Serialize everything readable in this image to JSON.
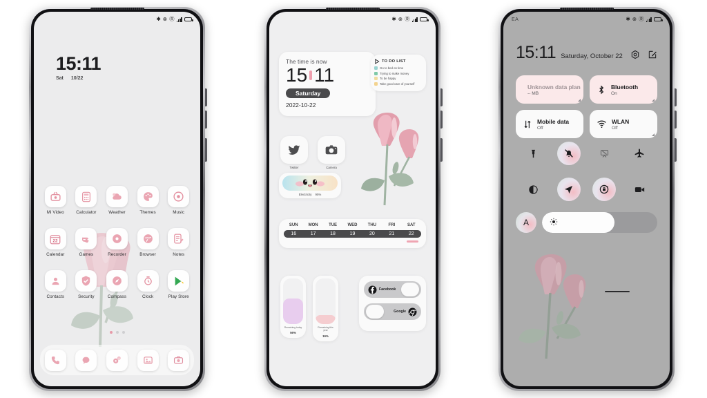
{
  "theme": {
    "pink": "#e79aa8",
    "petal": "#e8a0ae",
    "leaf": "#9caf9e",
    "home_bg": "#ececed",
    "cc_bg": "#adadad"
  },
  "phone1": {
    "name": "home-screen",
    "statusbar": {
      "icons": [
        "bluetooth-icon",
        "no-wifi-icon",
        "ringer-icon",
        "signal-icon",
        "battery-icon"
      ]
    },
    "clock": {
      "time": "15:11",
      "weekday": "Sat",
      "date": "10/22"
    },
    "apps": [
      {
        "label": "Mi Video",
        "icon": "mi-video-icon"
      },
      {
        "label": "Calculator",
        "icon": "calculator-icon"
      },
      {
        "label": "Weather",
        "icon": "weather-icon"
      },
      {
        "label": "Themes",
        "icon": "themes-icon"
      },
      {
        "label": "Music",
        "icon": "music-icon"
      },
      {
        "label": "Calendar",
        "icon": "calendar-icon",
        "badge": "22"
      },
      {
        "label": "Games",
        "icon": "games-icon"
      },
      {
        "label": "Recorder",
        "icon": "recorder-icon"
      },
      {
        "label": "Browser",
        "icon": "browser-icon"
      },
      {
        "label": "Notes",
        "icon": "notes-icon"
      },
      {
        "label": "Contacts",
        "icon": "contacts-icon"
      },
      {
        "label": "Security",
        "icon": "security-icon"
      },
      {
        "label": "Compass",
        "icon": "compass-icon"
      },
      {
        "label": "Clock",
        "icon": "clock-icon"
      },
      {
        "label": "Play Store",
        "icon": "play-store-icon"
      }
    ],
    "page_dots": {
      "count": 3,
      "active": 0
    },
    "dock": [
      {
        "label": "Phone",
        "icon": "phone-icon"
      },
      {
        "label": "Messages",
        "icon": "messages-icon"
      },
      {
        "label": "Settings",
        "icon": "settings-icon"
      },
      {
        "label": "Gallery",
        "icon": "gallery-icon"
      },
      {
        "label": "Camera",
        "icon": "camera-icon"
      }
    ]
  },
  "phone2": {
    "name": "widget-screen",
    "time_widget": {
      "lead": "The time is now",
      "hours": "15",
      "minutes": "11",
      "weekday": "Saturday",
      "date": "2022-10-22"
    },
    "todo_widget": {
      "title": "TO DO LIST",
      "items": [
        {
          "text": "Go to bed on time",
          "color": "#9ad3d0",
          "checked": false
        },
        {
          "text": "Trying to make money",
          "color": "#7fc9a8",
          "checked": true
        },
        {
          "text": "To be happy",
          "color": "#f0dca0",
          "checked": false
        },
        {
          "text": "Take good care of yourself",
          "color": "#f3d38e",
          "checked": true
        }
      ]
    },
    "apps": [
      {
        "label": "Twitter",
        "icon": "twitter-icon"
      },
      {
        "label": "Camera",
        "icon": "camera-icon"
      }
    ],
    "battery_widget": {
      "label": "Electricity",
      "value": "95%",
      "face": "kawaii-face-icon"
    },
    "calendar_widget": {
      "weekdays": [
        "SUN",
        "MON",
        "TUE",
        "WED",
        "THU",
        "FRI",
        "SAT"
      ],
      "dates": [
        "16",
        "17",
        "18",
        "19",
        "20",
        "21",
        "22"
      ],
      "selected_index": 6
    },
    "progress_widgets": [
      {
        "label": "Remaining today",
        "value": "56%",
        "percent": 56,
        "color": "#e8cdee"
      },
      {
        "label": "Remaining this year",
        "value": "19%",
        "percent": 19,
        "color": "#f5cdd0"
      }
    ],
    "toggle_widget": [
      {
        "label": "Facebook",
        "icon": "facebook-icon",
        "state": "left"
      },
      {
        "label": "Google",
        "icon": "chrome-icon",
        "state": "right"
      }
    ]
  },
  "phone3": {
    "name": "control-center",
    "statusbar": {
      "carrier": "EA",
      "icons": [
        "bluetooth-icon",
        "no-wifi-icon",
        "ringer-icon",
        "signal-icon",
        "battery-icon"
      ]
    },
    "header": {
      "time": "15:11",
      "date": "Saturday, October 22",
      "actions": [
        "settings-icon",
        "edit-icon"
      ]
    },
    "tiles": [
      {
        "title": "Unknown data plan",
        "subtitle": "-- MB",
        "icon": "data-drop-icon",
        "style": "pink"
      },
      {
        "title": "Bluetooth",
        "subtitle": "On",
        "icon": "bluetooth-icon",
        "style": "pink"
      },
      {
        "title": "Mobile data",
        "subtitle": "Off",
        "icon": "mobile-data-icon",
        "style": "plain"
      },
      {
        "title": "WLAN",
        "subtitle": "Off",
        "icon": "wlan-icon",
        "style": "plain"
      }
    ],
    "quick_toggles": [
      {
        "label": "Flashlight",
        "icon": "flashlight-icon",
        "active": false
      },
      {
        "label": "Silent",
        "icon": "bell-mute-icon",
        "active": true
      },
      {
        "label": "Cast",
        "icon": "cast-off-icon",
        "active": false,
        "dim": true
      },
      {
        "label": "Airplane mode",
        "icon": "airplane-icon",
        "active": false
      },
      {
        "label": "Dark mode",
        "icon": "contrast-icon",
        "active": false
      },
      {
        "label": "Location",
        "icon": "location-icon",
        "active": true
      },
      {
        "label": "Auto-rotate",
        "icon": "rotate-lock-icon",
        "active": true
      },
      {
        "label": "Screen recorder",
        "icon": "video-camera-icon",
        "active": false
      }
    ],
    "brightness": {
      "auto_label": "A",
      "icon": "sun-icon",
      "percent": 63
    }
  }
}
